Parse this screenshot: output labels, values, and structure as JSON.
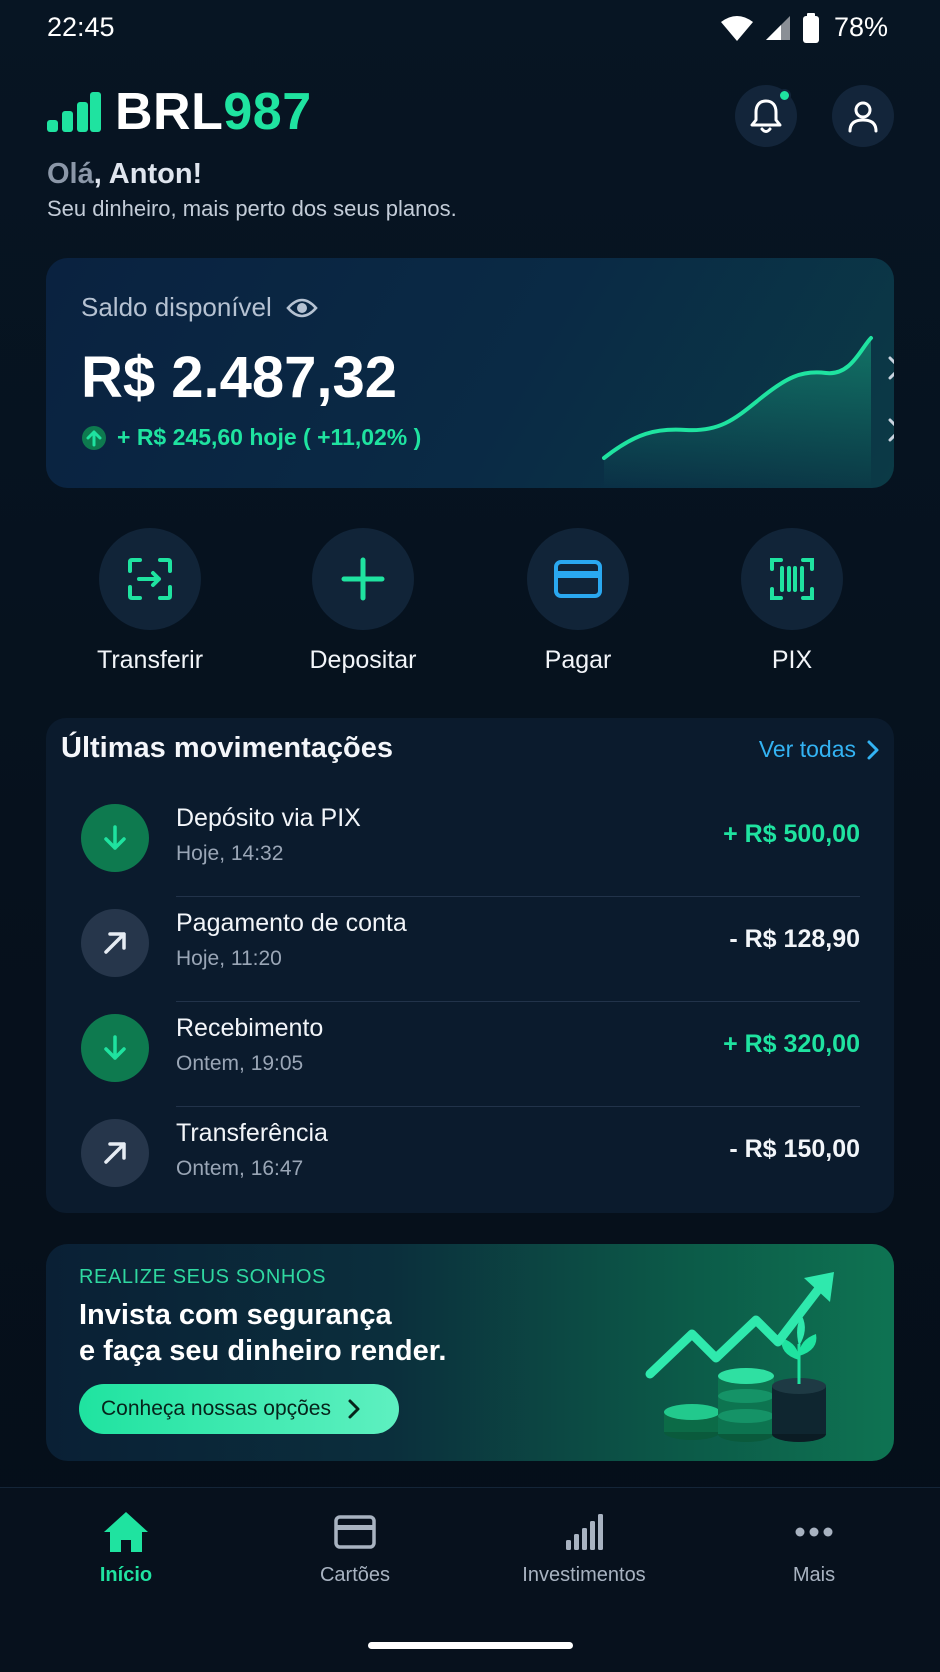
{
  "status_bar": {
    "time": "22:45",
    "battery": "78%"
  },
  "brand": {
    "name_a": "BRL",
    "name_b": "987"
  },
  "greeting": {
    "hi": "Olá",
    "name": ", Anton!",
    "subtitle": "Seu dinheiro, mais perto dos seus planos."
  },
  "balance": {
    "label": "Saldo disponível",
    "value": "R$ 2.487,32",
    "change": "+ R$ 245,60 hoje ( +11,02% )"
  },
  "actions": [
    {
      "label": "Transferir",
      "icon": "transfer-icon"
    },
    {
      "label": "Depositar",
      "icon": "plus-icon"
    },
    {
      "label": "Pagar",
      "icon": "card-icon"
    },
    {
      "label": "PIX",
      "icon": "pix-icon"
    }
  ],
  "transactions": {
    "title": "Últimas movimentações",
    "see_all": "Ver todas",
    "items": [
      {
        "name": "Depósito via PIX",
        "date": "Hoje, 14:32",
        "amount": "+ R$ 500,00",
        "direction": "in"
      },
      {
        "name": "Pagamento de conta",
        "date": "Hoje, 11:20",
        "amount": "- R$ 128,90",
        "direction": "out"
      },
      {
        "name": "Recebimento",
        "date": "Ontem, 19:05",
        "amount": "+ R$ 320,00",
        "direction": "in"
      },
      {
        "name": "Transferência",
        "date": "Ontem, 16:47",
        "amount": "- R$ 150,00",
        "direction": "out"
      }
    ]
  },
  "promo": {
    "kicker": "REALIZE SEUS SONHOS",
    "line1": "Invista com segurança",
    "line2": "e faça seu dinheiro render.",
    "button": "Conheça nossas opções"
  },
  "nav": [
    {
      "label": "Início",
      "icon": "home-icon",
      "active": true
    },
    {
      "label": "Cartões",
      "icon": "card-icon",
      "active": false
    },
    {
      "label": "Investimentos",
      "icon": "bar-chart-icon",
      "active": false
    },
    {
      "label": "Mais",
      "icon": "more-icon",
      "active": false
    }
  ],
  "colors": {
    "accent": "#1fe3a0",
    "link": "#33b3f3",
    "background": "#06121f"
  }
}
